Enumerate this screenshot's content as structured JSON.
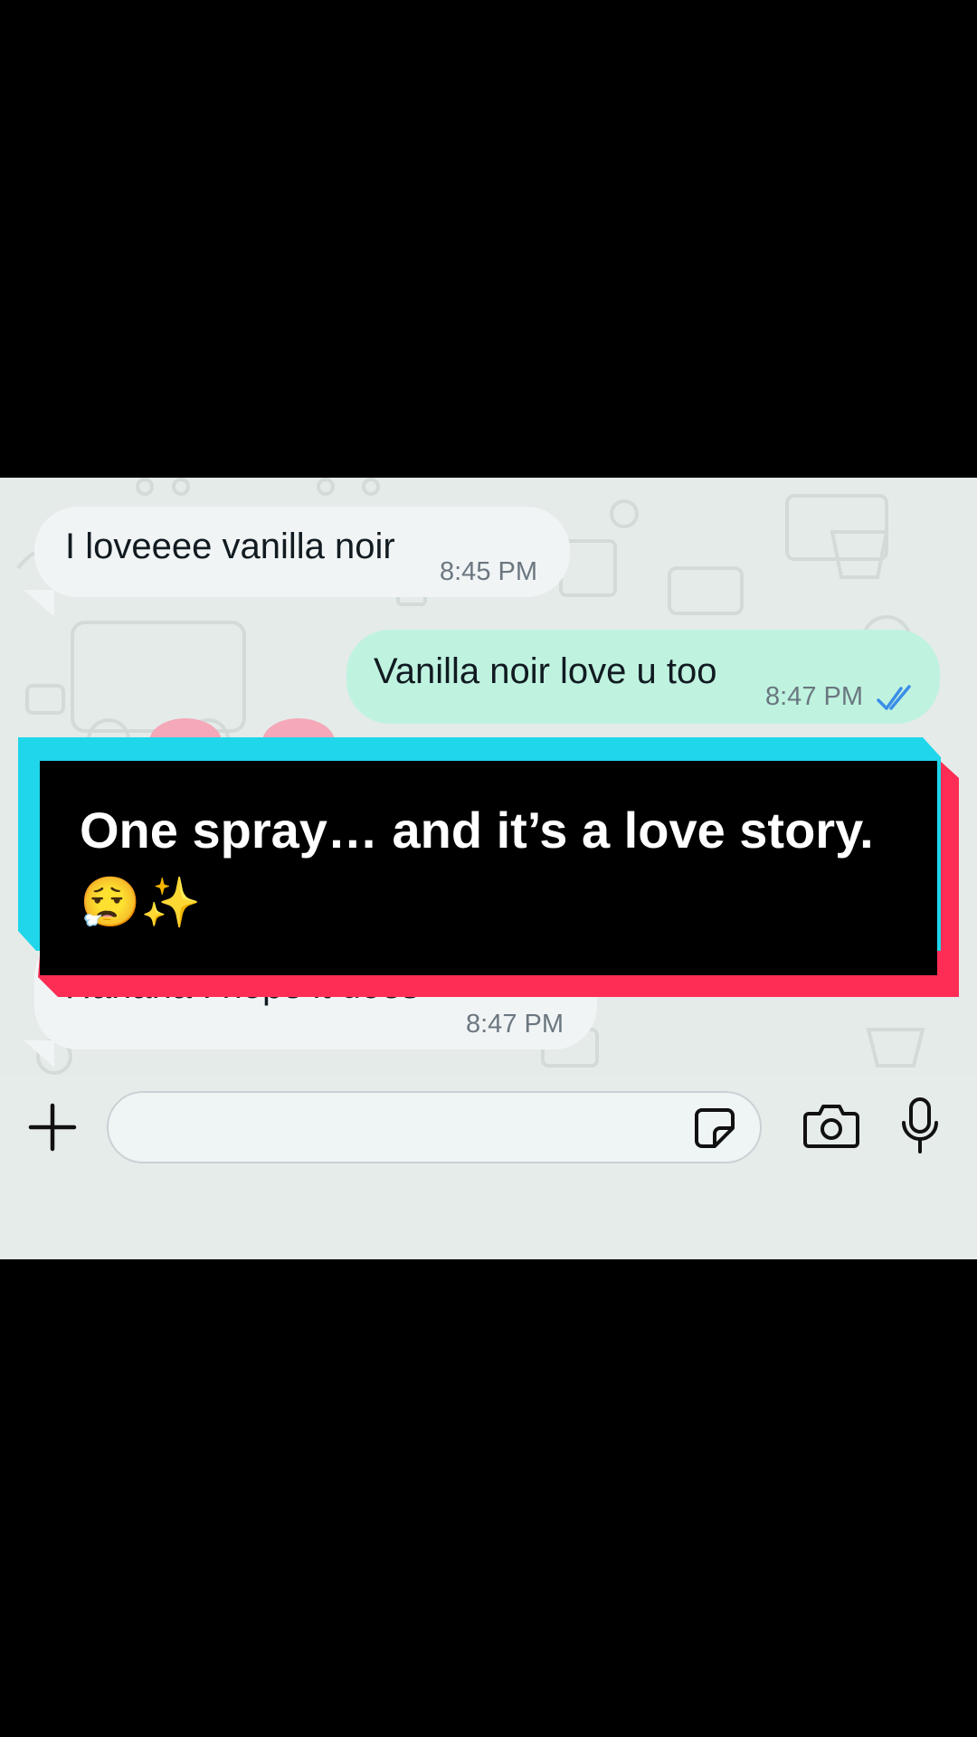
{
  "chat": {
    "messages": [
      {
        "direction": "incoming",
        "text": "I loveeee vanilla noir",
        "time": "8:45 PM"
      },
      {
        "direction": "outgoing",
        "text": "Vanilla noir love u too",
        "time": "8:47 PM",
        "status_icon": "double-check-read-icon"
      },
      {
        "direction": "incoming",
        "text": "Hahaha I hope it does",
        "time": "8:47 PM"
      }
    ]
  },
  "caption": {
    "text": "One spray… and it’s a love story.",
    "emoji": "😮‍💨✨"
  },
  "composer": {
    "placeholder": "",
    "icons": [
      "plus-icon",
      "sticker-icon",
      "camera-icon",
      "microphone-icon"
    ]
  },
  "colors": {
    "incoming_bubble": "#f1f4f5",
    "outgoing_bubble": "#bff3df",
    "read_ticks": "#3a8ee8",
    "caption_cyan": "#1fd6ea",
    "caption_red": "#fd2d55"
  }
}
